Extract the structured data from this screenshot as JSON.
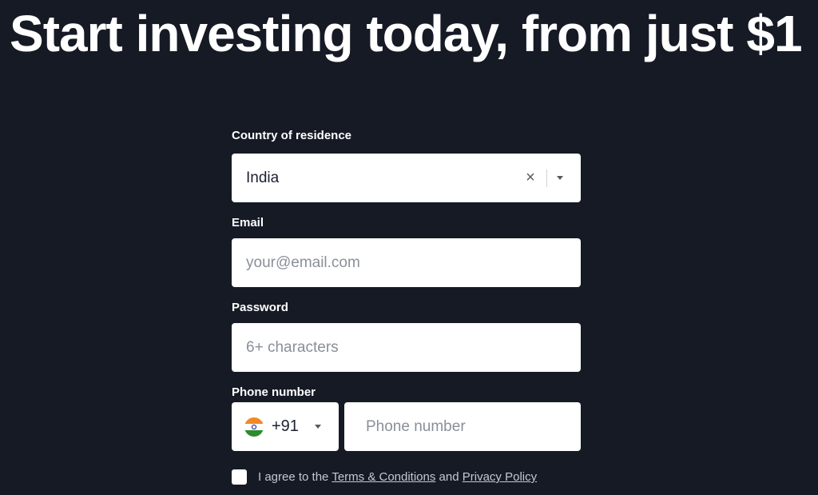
{
  "headline": "Start investing today, from just $1",
  "form": {
    "country": {
      "label": "Country of residence",
      "value": "India",
      "clear_icon": "close-icon",
      "dropdown_icon": "caret-down-icon"
    },
    "email": {
      "label": "Email",
      "placeholder": "your@email.com",
      "value": ""
    },
    "password": {
      "label": "Password",
      "placeholder": "6+ characters",
      "value": ""
    },
    "phone": {
      "label": "Phone number",
      "dial_code": "+91",
      "flag": "india-flag-icon",
      "placeholder": "Phone number",
      "value": ""
    },
    "agreement": {
      "prefix": "I agree to the",
      "terms_link": "Terms & Conditions",
      "conjunction": "and",
      "privacy_link": "Privacy Policy",
      "checked": false
    }
  },
  "colors": {
    "background": "#151a25",
    "field_background": "#ffffff",
    "text_dark": "#1b2130",
    "placeholder": "#8a8f99"
  }
}
